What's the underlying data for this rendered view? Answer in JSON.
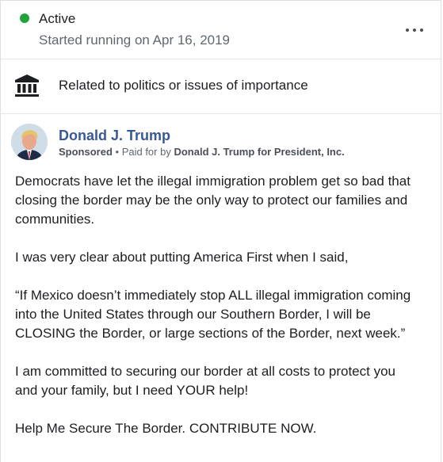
{
  "status": {
    "label": "Active",
    "started": "Started running on Apr 16, 2019",
    "color": "#1fa33a"
  },
  "menu": {
    "icon": "more-horizontal-icon"
  },
  "category": {
    "icon": "bank-building-icon",
    "text": "Related to politics or issues of importance"
  },
  "ad": {
    "advertiser": "Donald J. Trump",
    "sponsored_label": "Sponsored",
    "separator": " • ",
    "paid_for_prefix": "Paid for by ",
    "payer": "Donald J. Trump for President, Inc.",
    "avatar_icon": "advertiser-profile-photo",
    "body": {
      "p1_l1": "Democrats have let the illegal immigration problem get so bad that",
      "p1_l2": "closing the border may be the only way to protect our families and",
      "p1_l3": "communities.",
      "p2_l1": "I was very clear about putting America First when I said,",
      "p3_l1": "“If Mexico doesn’t immediately stop ALL illegal immigration coming",
      "p3_l2": "into the United States through our Southern Border, I will be",
      "p3_l3": "CLOSING the Border, or large sections of the Border, next week.”",
      "p4_l1": "I am committed to securing our border at all costs to protect you",
      "p4_l2": "and your family, but I need YOUR help!",
      "p5_l1": "Help Me Secure The Border. CONTRIBUTE NOW."
    }
  },
  "colors": {
    "link": "#385898",
    "secondary_text": "#606770",
    "divider": "#e4e6eb"
  }
}
